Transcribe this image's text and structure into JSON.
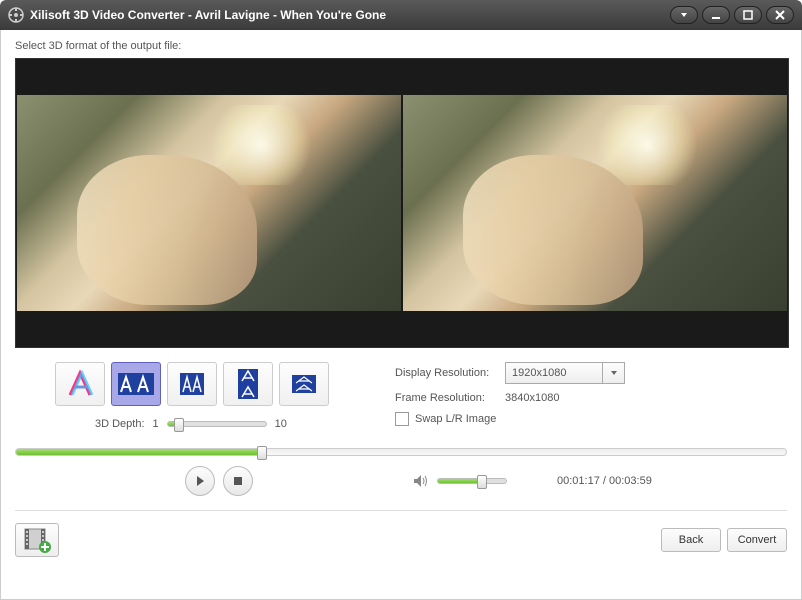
{
  "titlebar": {
    "title": "Xilisoft 3D Video Converter - Avril Lavigne - When You're Gone"
  },
  "instruction": "Select 3D format of the output file:",
  "formats": {
    "depth_label": "3D Depth:",
    "depth_min": "1",
    "depth_max": "10",
    "depth_value": 2
  },
  "resolution": {
    "display_label": "Display Resolution:",
    "display_value": "1920x1080",
    "frame_label": "Frame Resolution:",
    "frame_value": "3840x1080",
    "swap_label": "Swap L/R Image",
    "swap_checked": false
  },
  "playback": {
    "elapsed": "00:01:17",
    "total": "00:03:59",
    "separator": " / ",
    "progress_percent": 32,
    "volume_percent": 65
  },
  "buttons": {
    "back": "Back",
    "convert": "Convert"
  }
}
